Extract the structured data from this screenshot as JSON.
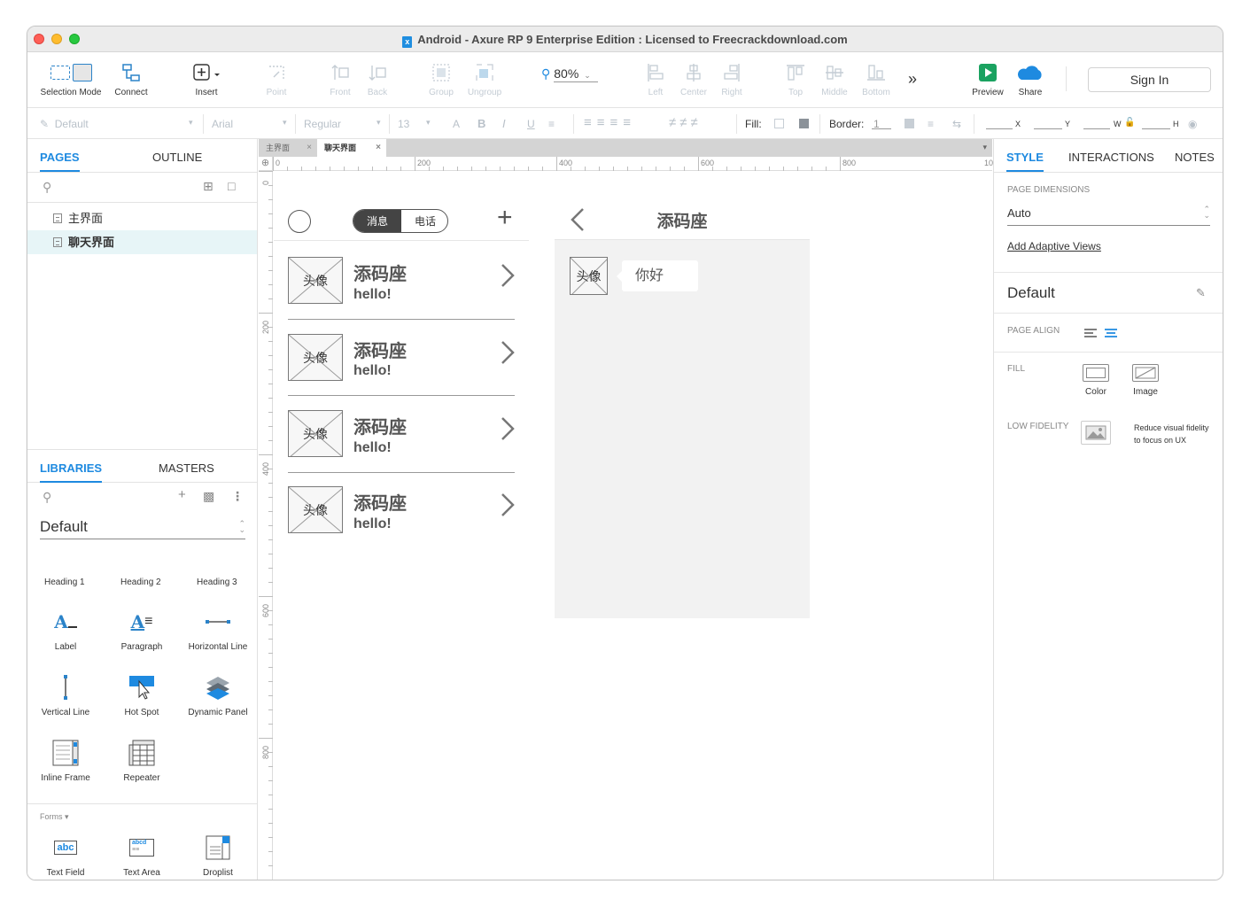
{
  "window": {
    "title": "Android - Axure RP 9 Enterprise Edition : Licensed to Freecrackdownload.com"
  },
  "toolbar": {
    "selection_mode": "Selection Mode",
    "connect": "Connect",
    "insert": "Insert",
    "point": "Point",
    "front": "Front",
    "back": "Back",
    "group": "Group",
    "ungroup": "Ungroup",
    "zoom": "80%",
    "left": "Left",
    "center": "Center",
    "right": "Right",
    "top": "Top",
    "middle": "Middle",
    "bottom": "Bottom",
    "more": "»",
    "preview": "Preview",
    "share": "Share",
    "sign_in": "Sign In"
  },
  "stylebar": {
    "style": "Default",
    "font": "Arial",
    "weight": "Regular",
    "size": "13",
    "fill_label": "Fill:",
    "border_label": "Border:",
    "border_value": "1",
    "x_label": "X",
    "y_label": "Y",
    "w_label": "W",
    "h_label": "H"
  },
  "pages_panel": {
    "tab_pages": "PAGES",
    "tab_outline": "OUTLINE",
    "pages": [
      {
        "label": "主界面"
      },
      {
        "label": "聊天界面"
      }
    ]
  },
  "libraries_panel": {
    "tab_libraries": "LIBRARIES",
    "tab_masters": "MASTERS",
    "library": "Default",
    "headings": [
      "Heading 1",
      "Heading 2",
      "Heading 3"
    ],
    "widgets": [
      {
        "label": "Label"
      },
      {
        "label": "Paragraph"
      },
      {
        "label": "Horizontal Line"
      },
      {
        "label": "Vertical Line"
      },
      {
        "label": "Hot Spot"
      },
      {
        "label": "Dynamic Panel"
      },
      {
        "label": "Inline Frame"
      },
      {
        "label": "Repeater"
      }
    ],
    "forms_label": "Forms ▾",
    "forms": [
      {
        "label": "Text Field",
        "icon_text": "abc"
      },
      {
        "label": "Text Area",
        "icon_text": "abcd"
      },
      {
        "label": "Droplist"
      }
    ]
  },
  "doc_tabs": [
    {
      "label": "主界面"
    },
    {
      "label": "聊天界面"
    }
  ],
  "rulers": {
    "h": [
      "0",
      "200",
      "400",
      "600",
      "800",
      "10"
    ],
    "v": [
      "0",
      "200",
      "400",
      "600",
      "800"
    ]
  },
  "canvas": {
    "screen1": {
      "segment_msg": "消息",
      "segment_call": "电话",
      "plus": "+",
      "chats": [
        {
          "avatar": "头像",
          "name": "添码座",
          "message": "hello!"
        },
        {
          "avatar": "头像",
          "name": "添码座",
          "message": "hello!"
        },
        {
          "avatar": "头像",
          "name": "添码座",
          "message": "hello!"
        },
        {
          "avatar": "头像",
          "name": "添码座",
          "message": "hello!"
        }
      ]
    },
    "screen2": {
      "back": "‹",
      "title": "添码座",
      "avatar": "头像",
      "bubble": "你好"
    }
  },
  "inspector": {
    "tab_style": "STYLE",
    "tab_interactions": "INTERACTIONS",
    "tab_notes": "NOTES",
    "page_dimensions_label": "PAGE DIMENSIONS",
    "page_dimensions_value": "Auto",
    "add_adaptive_views": "Add Adaptive Views",
    "style_name": "Default",
    "page_align_label": "PAGE ALIGN",
    "fill_label": "FILL",
    "fill_color": "Color",
    "fill_image": "Image",
    "low_fidelity_label": "LOW FIDELITY",
    "low_fidelity_text_1": "Reduce visual fidelity",
    "low_fidelity_text_2": "to focus on UX"
  },
  "colors": {
    "accent": "#1e8ae0",
    "preview_green": "#1aa260",
    "selected_page_bg": "#e7f5f7"
  }
}
